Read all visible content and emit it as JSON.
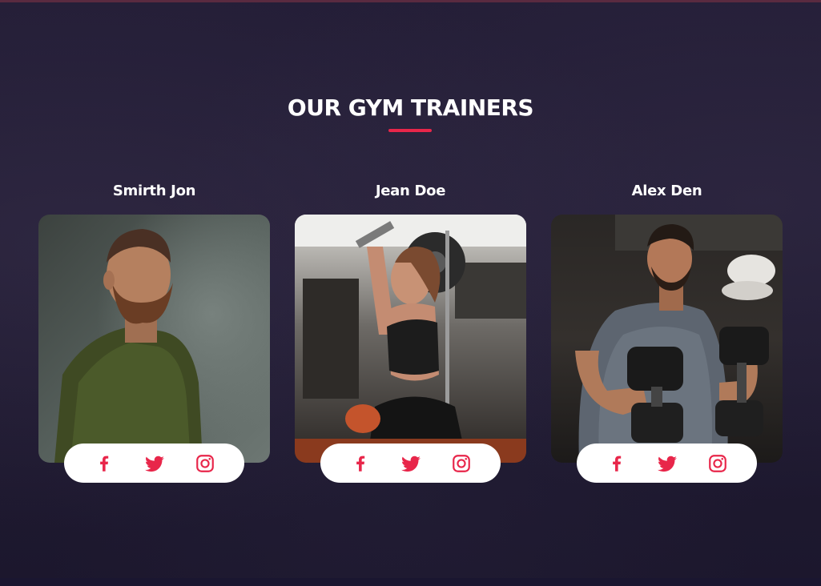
{
  "section": {
    "title": "OUR GYM TRAINERS"
  },
  "colors": {
    "accent": "#e8264a",
    "background": "#1d1830",
    "pill": "#ffffff",
    "title_text": "#ffffff"
  },
  "trainers": [
    {
      "name": "Smirth Jon",
      "photo": "bearded-man-green-shirt-photo",
      "socials": [
        "facebook-icon",
        "twitter-icon",
        "instagram-icon"
      ]
    },
    {
      "name": "Jean Doe",
      "photo": "woman-lat-pulldown-gym-photo",
      "socials": [
        "facebook-icon",
        "twitter-icon",
        "instagram-icon"
      ]
    },
    {
      "name": "Alex Den",
      "photo": "man-dumbbells-gym-photo",
      "socials": [
        "facebook-icon",
        "twitter-icon",
        "instagram-icon"
      ]
    }
  ]
}
